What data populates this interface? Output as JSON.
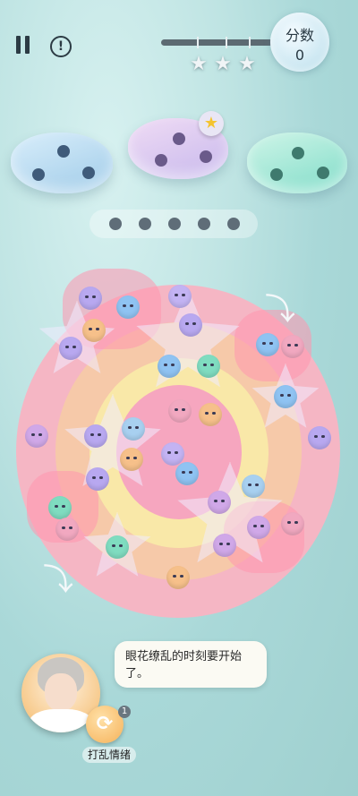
{
  "hud": {
    "score_label": "分数",
    "score_value": "0",
    "stars_earned": 0,
    "stars_total": 3,
    "progress": 0.0
  },
  "slots": {
    "count": 3,
    "queue_dots": 5
  },
  "dialogue": {
    "text": "眼花缭乱的时刻要开始了。"
  },
  "skill": {
    "label": "打乱情绪",
    "count": "1"
  },
  "icons": {
    "pause": "pause-icon",
    "help": "exclamation-icon",
    "star": "star-icon",
    "rotate": "rotate-arrow-icon"
  },
  "colors": {
    "accent_pink": "#ff96af",
    "bubble_teal": "#7fdcc8",
    "bubble_blue": "#a9cfe8",
    "bubble_lilac": "#d6c6ee",
    "skill_orange": "#f6b25a"
  }
}
